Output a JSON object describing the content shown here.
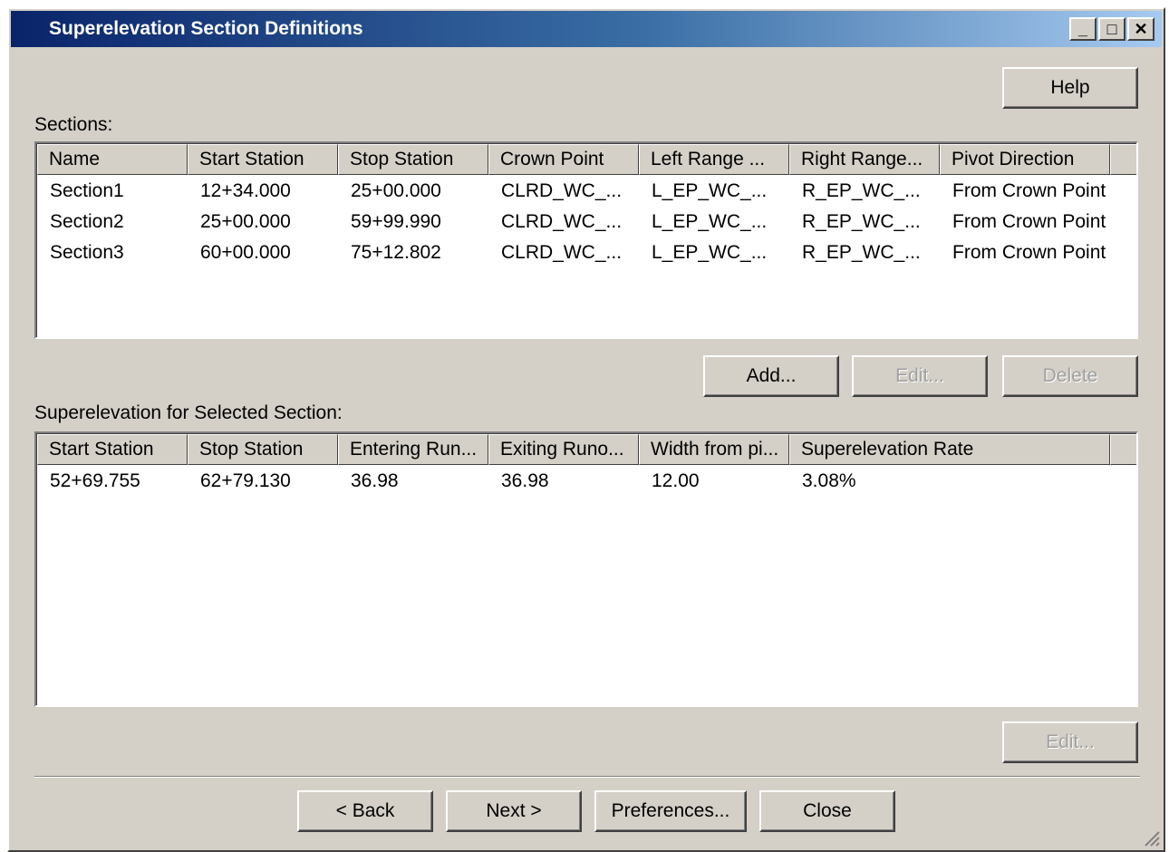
{
  "window": {
    "title": "Superelevation Section Definitions",
    "minimize_glyph": "_",
    "maximize_glyph": "□",
    "close_glyph": "✕"
  },
  "help_label": "Help",
  "sections": {
    "label": "Sections:",
    "columns": [
      "Name",
      "Start Station",
      "Stop Station",
      "Crown Point",
      "Left Range ...",
      "Right Range...",
      "Pivot Direction"
    ],
    "rows": [
      [
        "Section1",
        "12+34.000",
        "25+00.000",
        "CLRD_WC_...",
        "L_EP_WC_...",
        "R_EP_WC_...",
        "From Crown Point"
      ],
      [
        "Section2",
        "25+00.000",
        "59+99.990",
        "CLRD_WC_...",
        "L_EP_WC_...",
        "R_EP_WC_...",
        "From Crown Point"
      ],
      [
        "Section3",
        "60+00.000",
        "75+12.802",
        "CLRD_WC_...",
        "L_EP_WC_...",
        "R_EP_WC_...",
        "From Crown Point"
      ]
    ],
    "add_label": "Add...",
    "edit_label": "Edit...",
    "delete_label": "Delete"
  },
  "superelevation": {
    "label": "Superelevation for Selected Section:",
    "columns": [
      "Start Station",
      "Stop Station",
      "Entering Run...",
      "Exiting Runo...",
      "Width from pi...",
      "Superelevation Rate"
    ],
    "rows": [
      [
        "52+69.755",
        "62+79.130",
        "36.98",
        "36.98",
        "12.00",
        "3.08%"
      ]
    ],
    "edit_label": "Edit..."
  },
  "footer": {
    "back_label": "< Back",
    "next_label": "Next >",
    "preferences_label": "Preferences...",
    "close_label": "Close"
  },
  "colors": {
    "dialog_face": "#d4d0c8",
    "title_gradient_start": "#0a246a",
    "title_gradient_end": "#a6caf0"
  }
}
